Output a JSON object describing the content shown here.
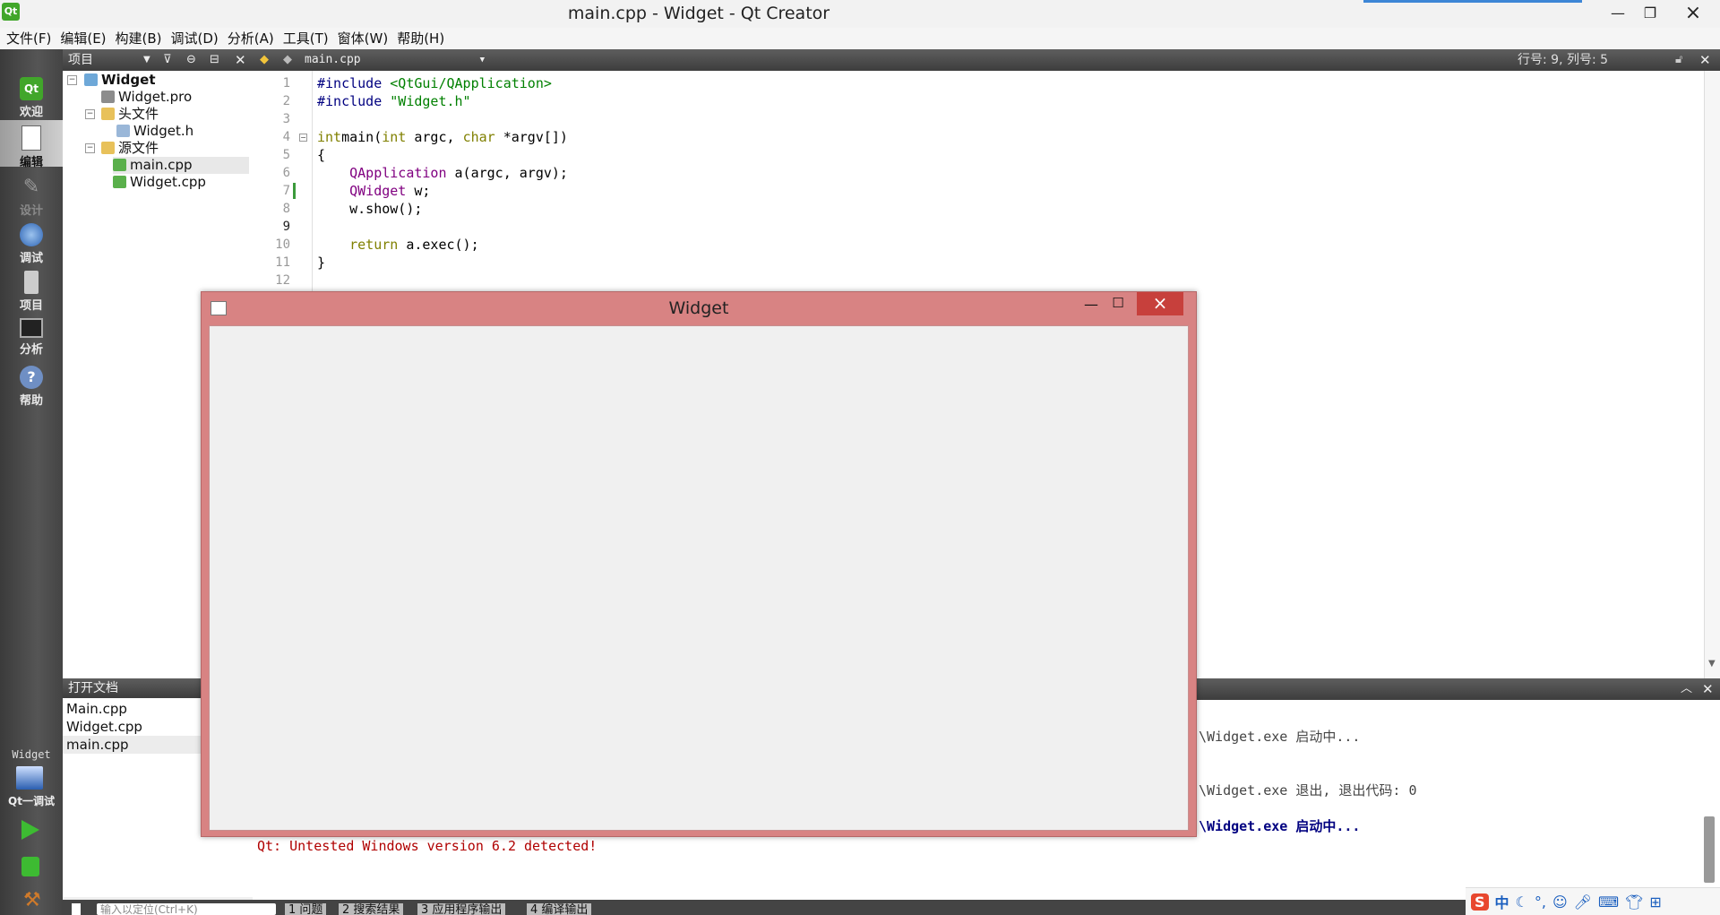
{
  "window": {
    "title": "main.cpp - Widget - Qt Creator",
    "app_icon": "Qt"
  },
  "menu": [
    "文件(F)",
    "编辑(E)",
    "构建(B)",
    "调试(D)",
    "分析(A)",
    "工具(T)",
    "窗体(W)",
    "帮助(H)"
  ],
  "modes": [
    {
      "label": "欢迎",
      "icon": "qt-logo-icon",
      "active": false
    },
    {
      "label": "编辑",
      "icon": "document-icon",
      "active": true
    },
    {
      "label": "设计",
      "icon": "pencil-ruler-icon",
      "active": false,
      "disabled": true
    },
    {
      "label": "调试",
      "icon": "bug-icon",
      "active": false
    },
    {
      "label": "项目",
      "icon": "wrench-book-icon",
      "active": false
    },
    {
      "label": "分析",
      "icon": "monitor-icon",
      "active": false
    },
    {
      "label": "帮助",
      "icon": "question-icon",
      "active": false
    }
  ],
  "project_panel": {
    "title": "项目",
    "tree": {
      "root": "Widget",
      "pro_file": "Widget.pro",
      "headers_folder": "头文件",
      "header_file": "Widget.h",
      "sources_folder": "源文件",
      "source_main": "main.cpp",
      "source_widget": "Widget.cpp"
    }
  },
  "open_docs": {
    "title": "打开文档",
    "items": [
      "Main.cpp",
      "Widget.cpp",
      "main.cpp"
    ]
  },
  "editor": {
    "file": "main.cpp",
    "cursor": "行号: 9, 列号: 5",
    "line_numbers": [
      "1",
      "2",
      "3",
      "4",
      "5",
      "6",
      "7",
      "8",
      "9",
      "10",
      "11",
      "12"
    ]
  },
  "output": {
    "line1": "\\Widget.exe 启动中...",
    "line2": "\\Widget.exe 退出, 退出代码: 0",
    "line3": "\\Widget.exe 启动中...",
    "line4": "Qt: Untested Windows version 6.2 detected!"
  },
  "build": {
    "target": "Widget",
    "mode": "Qt一调试"
  },
  "status": {
    "locator_placeholder": "输入以定位(Ctrl+K)",
    "tabs": [
      "1 问题",
      "2 搜索结果",
      "3 应用程序输出",
      "4 编译输出"
    ]
  },
  "widget_window": {
    "title": "Widget"
  },
  "ime": {
    "label": "中",
    "logo": "S"
  },
  "colors": {
    "keyword": "#808000",
    "preproc": "#000080",
    "string": "#008000",
    "type": "#800080",
    "modebar": "#444444"
  }
}
